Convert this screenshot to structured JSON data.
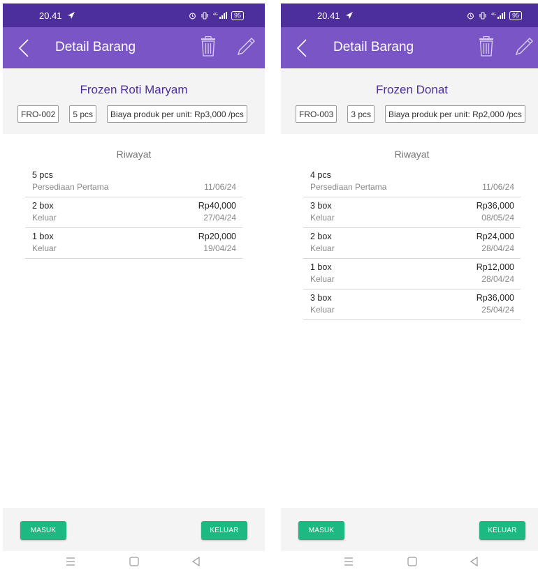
{
  "screens": [
    {
      "status": {
        "time": "20.41",
        "battery": "95"
      },
      "app_bar": {
        "title": "Detail Barang"
      },
      "product": {
        "name": "Frozen Roti Maryam",
        "code": "FRO-002",
        "stock": "5 pcs",
        "unit_cost": "Biaya produk per unit: Rp3,000 /pcs"
      },
      "history_title": "Riwayat",
      "history": [
        {
          "qty": "5 pcs",
          "amount": "",
          "kind": "Persediaan Pertama",
          "date": "11/06/24"
        },
        {
          "qty": "2 box",
          "amount": "Rp40,000",
          "kind": "Keluar",
          "date": "27/04/24"
        },
        {
          "qty": "1 box",
          "amount": "Rp20,000",
          "kind": "Keluar",
          "date": "19/04/24"
        }
      ],
      "buttons": {
        "masuk": "MASUK",
        "keluar": "KELUAR"
      }
    },
    {
      "status": {
        "time": "20.41",
        "battery": "95"
      },
      "app_bar": {
        "title": "Detail Barang"
      },
      "product": {
        "name": "Frozen Donat",
        "code": "FRO-003",
        "stock": "3 pcs",
        "unit_cost": "Biaya produk per unit: Rp2,000 /pcs"
      },
      "history_title": "Riwayat",
      "history": [
        {
          "qty": "4 pcs",
          "amount": "",
          "kind": "Persediaan Pertama",
          "date": "11/06/24"
        },
        {
          "qty": "3 box",
          "amount": "Rp36,000",
          "kind": "Keluar",
          "date": "08/05/24"
        },
        {
          "qty": "2 box",
          "amount": "Rp24,000",
          "kind": "Keluar",
          "date": "28/04/24"
        },
        {
          "qty": "1 box",
          "amount": "Rp12,000",
          "kind": "Keluar",
          "date": "28/04/24"
        },
        {
          "qty": "3 box",
          "amount": "Rp36,000",
          "kind": "Keluar",
          "date": "25/04/24"
        }
      ],
      "buttons": {
        "masuk": "MASUK",
        "keluar": "KELUAR"
      }
    }
  ],
  "colors": {
    "status_bar": "#4d2f9c",
    "app_bar": "#7a55c6",
    "accent_text": "#4d2f9c",
    "button_green": "#1db983",
    "panel_gray": "#f4f4f4"
  },
  "icons": {
    "status": [
      "send-arrow-icon",
      "alarm-icon",
      "vibrate-icon",
      "signal-icon",
      "battery-icon"
    ],
    "app_bar": [
      "chevron-left-icon",
      "trash-icon",
      "pencil-icon"
    ],
    "nav": [
      "menu-lines-icon",
      "square-home-icon",
      "triangle-back-icon"
    ]
  }
}
